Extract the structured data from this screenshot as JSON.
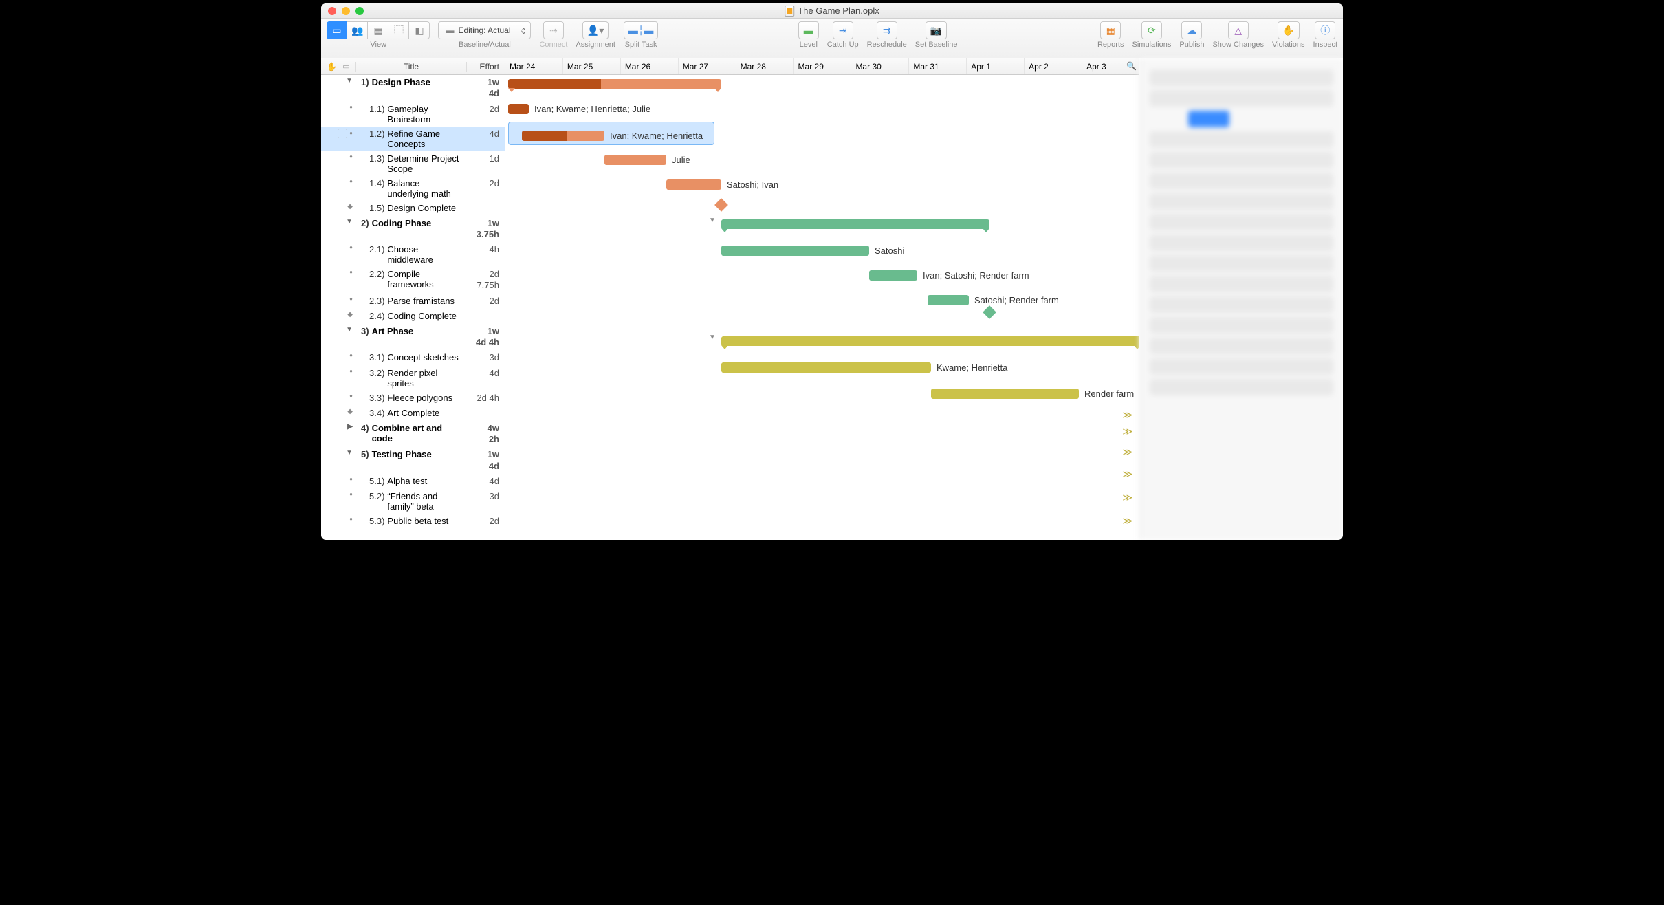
{
  "window_title": "The Game Plan.oplx",
  "toolbar": {
    "view_label": "View",
    "baseline_label": "Baseline/Actual",
    "baseline_value": "Editing: Actual",
    "connect_label": "Connect",
    "assignment_label": "Assignment",
    "split_label": "Split Task",
    "level_label": "Level",
    "catchup_label": "Catch Up",
    "reschedule_label": "Reschedule",
    "setbaseline_label": "Set Baseline",
    "reports_label": "Reports",
    "simulations_label": "Simulations",
    "publish_label": "Publish",
    "showchanges_label": "Show Changes",
    "violations_label": "Violations",
    "inspect_label": "Inspect"
  },
  "outline": {
    "header_title": "Title",
    "header_effort": "Effort",
    "rows": [
      {
        "type": "group",
        "num": "1)",
        "title": "Design Phase",
        "effort": "1w\n4d",
        "open": true
      },
      {
        "type": "task",
        "num": "1.1)",
        "title": "Gameplay Brainstorm",
        "effort": "2d"
      },
      {
        "type": "task",
        "num": "1.2)",
        "title": "Refine Game Concepts",
        "effort": "4d",
        "selected": true,
        "note": true
      },
      {
        "type": "task",
        "num": "1.3)",
        "title": "Determine Project Scope",
        "effort": "1d"
      },
      {
        "type": "task",
        "num": "1.4)",
        "title": "Balance underlying math",
        "effort": "2d"
      },
      {
        "type": "milestone",
        "num": "1.5)",
        "title": "Design Complete",
        "effort": ""
      },
      {
        "type": "group",
        "num": "2)",
        "title": "Coding Phase",
        "effort": "1w\n3.75h",
        "open": true
      },
      {
        "type": "task",
        "num": "2.1)",
        "title": "Choose middleware",
        "effort": "4h"
      },
      {
        "type": "task",
        "num": "2.2)",
        "title": "Compile frameworks",
        "effort": "2d\n7.75h"
      },
      {
        "type": "task",
        "num": "2.3)",
        "title": "Parse framistans",
        "effort": "2d"
      },
      {
        "type": "milestone",
        "num": "2.4)",
        "title": "Coding Complete",
        "effort": ""
      },
      {
        "type": "group",
        "num": "3)",
        "title": "Art Phase",
        "effort": "1w\n4d 4h",
        "open": true
      },
      {
        "type": "task",
        "num": "3.1)",
        "title": "Concept sketches",
        "effort": "3d"
      },
      {
        "type": "task",
        "num": "3.2)",
        "title": "Render pixel sprites",
        "effort": "4d"
      },
      {
        "type": "task",
        "num": "3.3)",
        "title": "Fleece polygons",
        "effort": "2d 4h"
      },
      {
        "type": "milestone",
        "num": "3.4)",
        "title": "Art Complete",
        "effort": ""
      },
      {
        "type": "group",
        "num": "4)",
        "title": "Combine art and code",
        "effort": "4w\n2h",
        "open": false
      },
      {
        "type": "group",
        "num": "5)",
        "title": "Testing Phase",
        "effort": "1w\n4d",
        "open": true
      },
      {
        "type": "task",
        "num": "5.1)",
        "title": "Alpha test",
        "effort": "4d"
      },
      {
        "type": "task",
        "num": "5.2)",
        "title": "“Friends and family” beta",
        "effort": "3d"
      },
      {
        "type": "task",
        "num": "5.3)",
        "title": "Public beta test",
        "effort": "2d"
      }
    ]
  },
  "gantt": {
    "dates": [
      "Mar 24",
      "Mar 25",
      "Mar 26",
      "Mar 27",
      "Mar 28",
      "Mar 29",
      "Mar 30",
      "Mar 31",
      "Apr 1",
      "Apr 2",
      "Apr 3"
    ],
    "bars": {
      "design_group": {
        "start": 0,
        "len": 310,
        "split": 135
      },
      "brainstorm": {
        "start": 0,
        "len": 30,
        "label": "Ivan; Kwame; Henrietta; Julie"
      },
      "refine": {
        "start": 20,
        "len": 120,
        "split": 65,
        "label": "Ivan; Kwame; Henrietta",
        "sel_start": 0,
        "sel_len": 300
      },
      "scope": {
        "start": 140,
        "len": 90,
        "label": "Julie"
      },
      "balance": {
        "start": 230,
        "len": 80,
        "label": "Satoshi; Ivan"
      },
      "design_ms": {
        "start": 303
      },
      "coding_group": {
        "start": 310,
        "len": 390
      },
      "middleware": {
        "start": 310,
        "len": 215,
        "label": "Satoshi"
      },
      "frameworks": {
        "start": 525,
        "len": 70,
        "label": "Ivan; Satoshi; Render farm"
      },
      "framistans": {
        "start": 610,
        "len": 60,
        "label": "Satoshi; Render farm"
      },
      "coding_ms": {
        "start": 693
      },
      "art_group": {
        "start": 310,
        "len": 610
      },
      "sketches": {
        "start": 310,
        "len": 305,
        "label": "Kwame; Henrietta"
      },
      "sprites": {
        "start": 615,
        "len": 215,
        "label": "Render farm"
      }
    }
  }
}
